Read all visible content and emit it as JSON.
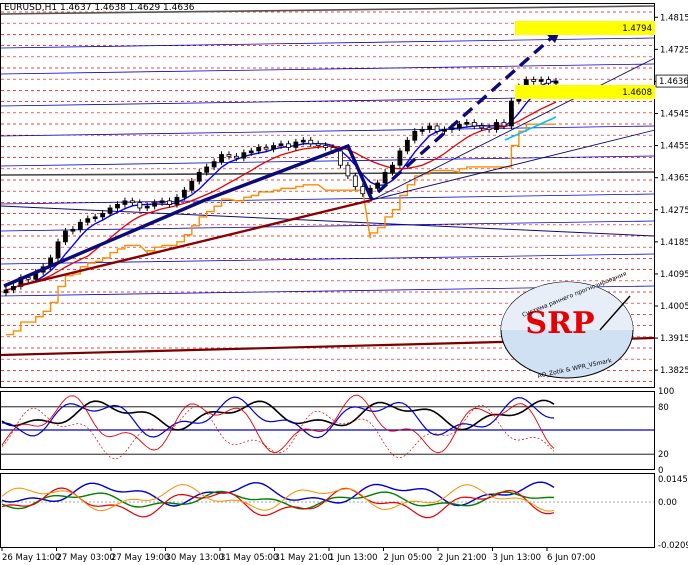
{
  "chart_data": {
    "type": "candlestick",
    "title": "EURUSD,H1  1.4637 1.4638 1.4629 1.4636",
    "main": {
      "y_ticks": [
        "1.4815",
        "1.4725",
        "1.4635",
        "1.4545",
        "1.4455",
        "1.4365",
        "1.4275",
        "1.4185",
        "1.4095",
        "1.4005",
        "1.3915",
        "1.3825"
      ],
      "y_range": [
        1.3775,
        1.4855
      ],
      "current_price": "1.4636",
      "target_label": "1.4794",
      "support_label": "1.4608",
      "close": [
        1.405,
        1.406,
        1.4085,
        1.408,
        1.41,
        1.4115,
        1.414,
        1.4185,
        1.4215,
        1.422,
        1.424,
        1.425,
        1.4255,
        1.4265,
        1.428,
        1.429,
        1.43,
        1.4295,
        1.428,
        1.4285,
        1.4295,
        1.43,
        1.429,
        1.431,
        1.433,
        1.4355,
        1.438,
        1.4395,
        1.441,
        1.443,
        1.4425,
        1.442,
        1.4435,
        1.444,
        1.445,
        1.4445,
        1.4455,
        1.446,
        1.445,
        1.4465,
        1.447,
        1.446,
        1.4455,
        1.445,
        1.444,
        1.44,
        1.437,
        1.434,
        1.432,
        1.4335,
        1.435,
        1.438,
        1.44,
        1.444,
        1.447,
        1.4495,
        1.45,
        1.451,
        1.4495,
        1.45,
        1.4505,
        1.4515,
        1.452,
        1.451,
        1.4505,
        1.45,
        1.452,
        1.451,
        1.458,
        1.462,
        1.464,
        1.4635,
        1.464,
        1.463,
        1.4636
      ]
    },
    "x_ticks": [
      "26 May 11:00",
      "27 May 03:00",
      "27 May 19:00",
      "30 May 13:00",
      "31 May 05:00",
      "31 May 21:00",
      "1 Jun 13:00",
      "2 Jun 05:00",
      "2 Jun 21:00",
      "3 Jun 13:00",
      "6 Jun 07:00"
    ],
    "osc1": {
      "y_ticks": [
        "0",
        "20",
        "80",
        "100"
      ]
    },
    "osc2": {
      "y_ticks": [
        "0.01455",
        "0.00",
        "-0.02094"
      ]
    },
    "logo": {
      "big": "SRP",
      "arc": "Система раннего прогнозирования",
      "sub": "AO_Zotik & WPR_VSmark"
    },
    "colors": {
      "up": "#000000",
      "down": "#ffffff",
      "trend": "#0a0a78",
      "support": "#8b0000",
      "orange": "#ff8c00",
      "red_dash": "#ff0000",
      "blue_line": "#0000cd",
      "highlight": "#ffff00",
      "cyan": "#00bfff",
      "green": "#008000"
    }
  }
}
